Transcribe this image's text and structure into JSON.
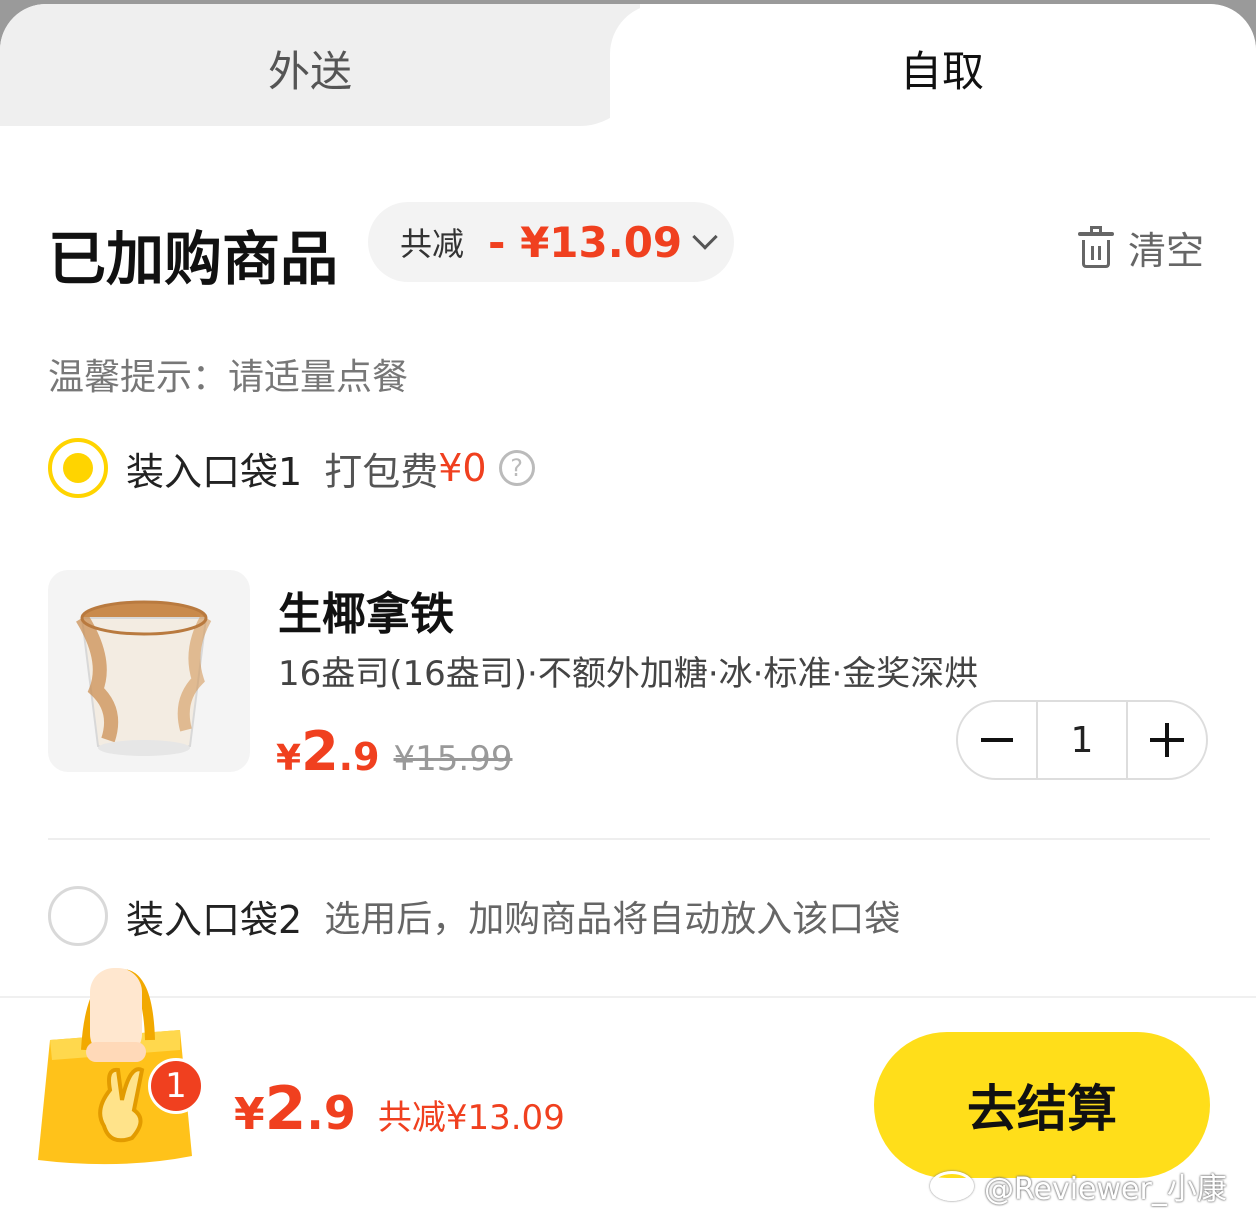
{
  "tabs": {
    "delivery": "外送",
    "pickup": "自取"
  },
  "cart": {
    "title": "已加购商品",
    "discount_label": "共减",
    "discount_value": "- ¥13.09",
    "clear_label": "清空",
    "tip": "温馨提示：请适量点餐"
  },
  "bags": [
    {
      "name": "装入口袋1",
      "fee_label": "打包费",
      "fee_amount": "¥0",
      "selected": true
    },
    {
      "name": "装入口袋2",
      "note": "选用后，加购商品将自动放入该口袋",
      "selected": false
    }
  ],
  "product": {
    "name": "生椰拿铁",
    "spec": "16盎司(16盎司)·不额外加糖·冰·标准·金奖深烘",
    "price_symbol": "¥",
    "price_int": "2",
    "price_dec": ".9",
    "original_price": "¥15.99",
    "quantity": "1"
  },
  "footer": {
    "badge_count": "1",
    "total_symbol": "¥",
    "total_int": "2",
    "total_dec": ".9",
    "total_saved": "共减¥13.09",
    "checkout_label": "去结算",
    "watermark": "@Reviewer_小康"
  },
  "colors": {
    "accent_yellow": "#ffde1a",
    "price_red": "#f0401f"
  }
}
